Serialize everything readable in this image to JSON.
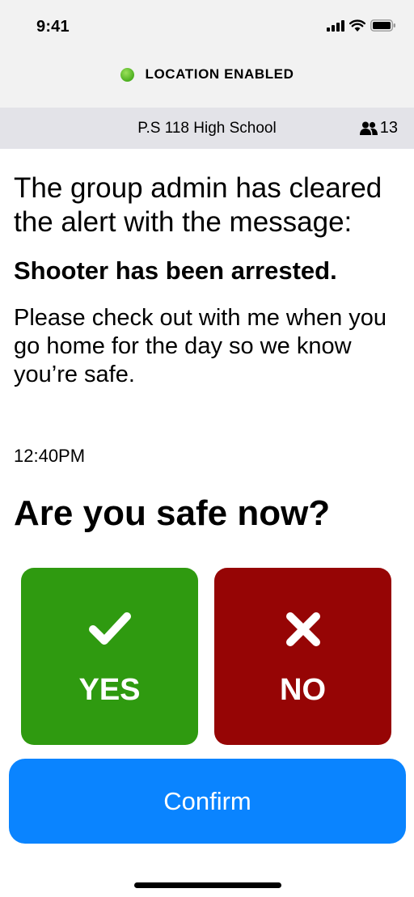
{
  "status_bar": {
    "time": "9:41",
    "icons": [
      "cellular-signal-icon",
      "wifi-icon",
      "battery-icon"
    ]
  },
  "location": {
    "label": "LOCATION ENABLED",
    "indicator_color": "#4caf1f"
  },
  "group": {
    "name": "P.S 118 High School",
    "member_icon": "people-icon",
    "member_count": "13"
  },
  "message": {
    "intro": "The group admin has cleared the alert with the message:",
    "headline": "Shooter has been arrested.",
    "body": "Please check out with me when you go home for the day so we know you’re safe.",
    "timestamp": "12:40PM"
  },
  "question": "Are you safe now?",
  "answers": {
    "yes": {
      "label": "YES",
      "icon": "checkmark-icon",
      "color": "#2f9a10"
    },
    "no": {
      "label": "NO",
      "icon": "x-mark-icon",
      "color": "#960505"
    }
  },
  "confirm": {
    "label": "Confirm",
    "color": "#0a84ff"
  }
}
